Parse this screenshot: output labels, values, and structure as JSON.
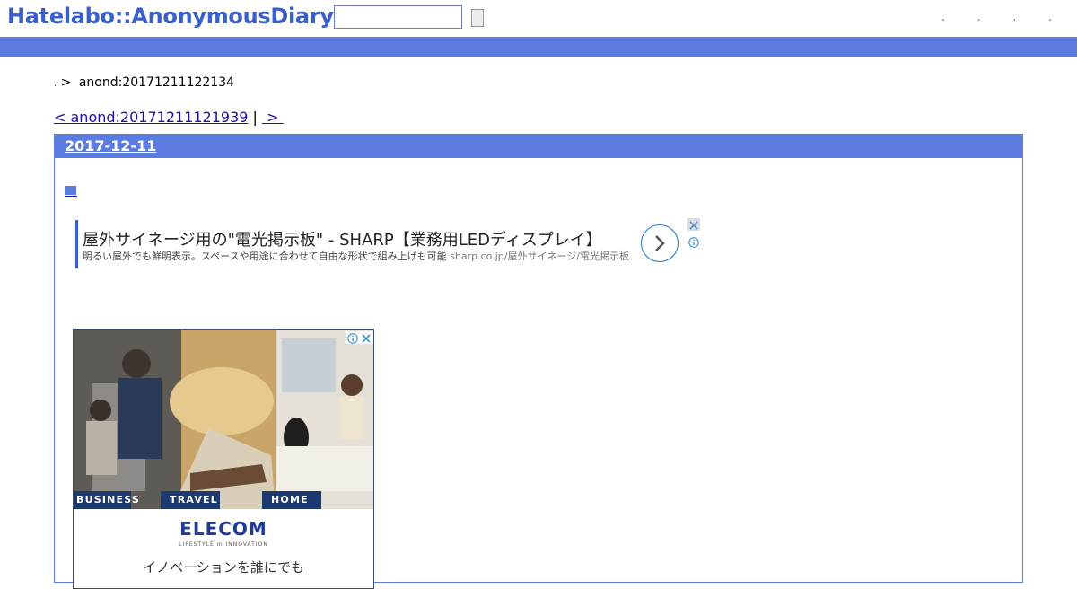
{
  "header": {
    "logo": "Hatelabo::AnonymousDiary",
    "search": {
      "value": "",
      "placeholder": ""
    },
    "menu_dots": ". . . ."
  },
  "breadcrumb": {
    "prefix": ".",
    "separator": ">",
    "current": "anond:20171211122134"
  },
  "pager": {
    "prev_label": "< anond:20171211121939",
    "divider": "|",
    "next_label": " > "
  },
  "entry": {
    "date": "2017-12-11",
    "title_marker": "■"
  },
  "text_ad": {
    "title": "屋外サイネージ用の\"電光掲示板\" - SHARP【業務用LEDディスプレイ】",
    "description": "明るい屋外でも鮮明表示。スペースや用途に合わせて自由な形状で組み上げも可能",
    "url": "sharp.co.jp/屋外サイネージ/電光掲示板"
  },
  "image_ad": {
    "band_labels": [
      "BUSINESS",
      "TRAVEL",
      "HOME"
    ],
    "brand": "ELECOM",
    "tagline": "LIFESTYLE m INNOVATION",
    "catch": "イノベーションを誰にでも"
  },
  "colors": {
    "accent_blue": "#5b7be0",
    "logo_blue": "#3a5fcd",
    "link": "#1a0dab"
  }
}
